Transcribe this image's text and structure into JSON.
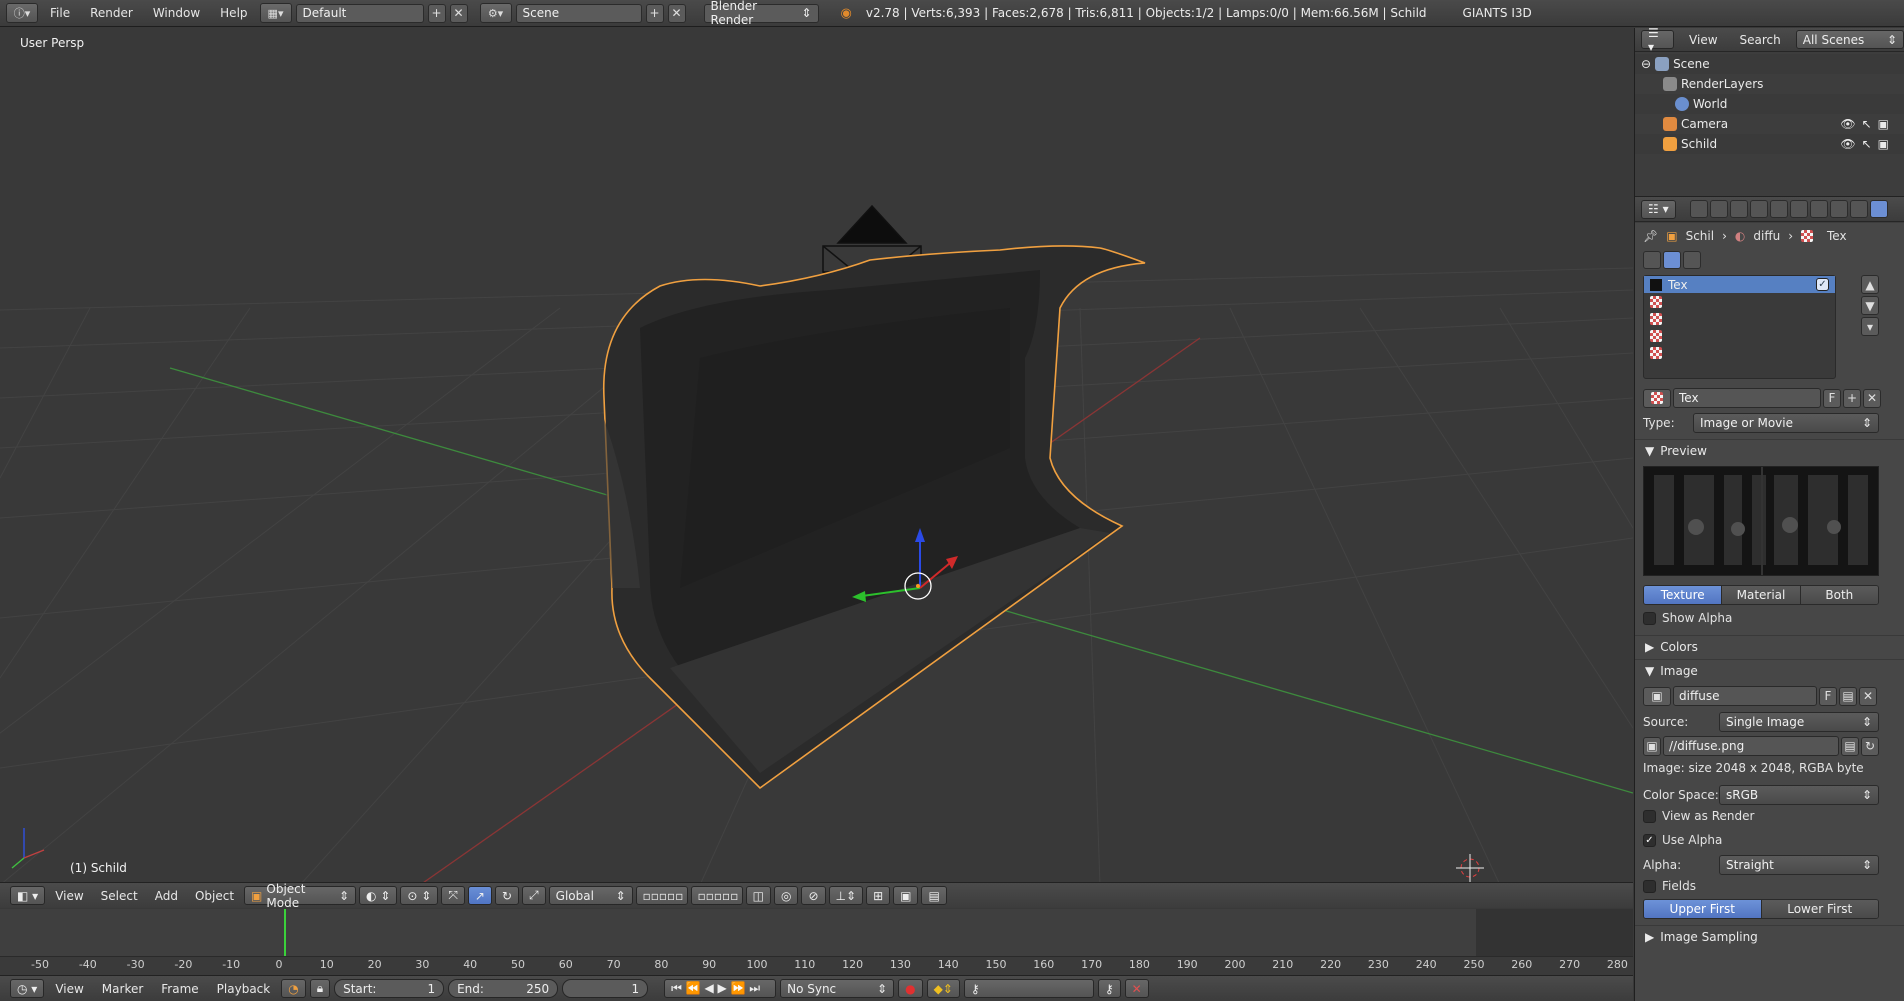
{
  "topbar": {
    "menus": [
      "File",
      "Render",
      "Window",
      "Help"
    ],
    "layout": "Default",
    "scene": "Scene",
    "engine": "Blender Render",
    "stats": "v2.78 | Verts:6,393 | Faces:2,678 | Tris:6,811 | Objects:1/2 | Lamps:0/0 | Mem:66.56M | Schild",
    "addon": "GIANTS I3D"
  },
  "viewport": {
    "view_label": "User Persp",
    "object_label": "(1) Schild"
  },
  "viewport_header": {
    "menus": [
      "View",
      "Select",
      "Add",
      "Object"
    ],
    "mode": "Object Mode",
    "orientation": "Global"
  },
  "timeline": {
    "ticks": [
      "-50",
      "-40",
      "-30",
      "-20",
      "-10",
      "0",
      "10",
      "20",
      "30",
      "40",
      "50",
      "60",
      "70",
      "80",
      "90",
      "100",
      "110",
      "120",
      "130",
      "140",
      "150",
      "160",
      "170",
      "180",
      "190",
      "200",
      "210",
      "220",
      "230",
      "240",
      "250",
      "260",
      "270",
      "280"
    ],
    "current_frame_value": 1,
    "menus": [
      "View",
      "Marker",
      "Frame",
      "Playback"
    ],
    "start_label": "Start:",
    "start_value": "1",
    "end_label": "End:",
    "end_value": "250",
    "current_frame": "1",
    "sync": "No Sync"
  },
  "outliner": {
    "header_menus": [
      "View",
      "Search"
    ],
    "scope": "All Scenes",
    "items": [
      "Scene",
      "RenderLayers",
      "World",
      "Camera",
      "Schild"
    ]
  },
  "properties": {
    "breadcrumb": [
      "Schil",
      "diffu",
      "Tex"
    ],
    "texture_slots": [
      "Tex",
      "",
      "",
      "",
      ""
    ],
    "texture_name": "Tex",
    "type_label": "Type:",
    "type_value": "Image or Movie",
    "preview_title": "Preview",
    "preview_tabs": [
      "Texture",
      "Material",
      "Both"
    ],
    "show_alpha": "Show Alpha",
    "colors_title": "Colors",
    "image_title": "Image",
    "image_name": "diffuse",
    "source_label": "Source:",
    "source_value": "Single Image",
    "filepath": "//diffuse.png",
    "image_info": "Image: size 2048 x 2048, RGBA byte",
    "color_space_label": "Color Space:",
    "color_space_value": "sRGB",
    "view_as_render": "View as Render",
    "use_alpha": "Use Alpha",
    "alpha_label": "Alpha:",
    "alpha_value": "Straight",
    "fields": "Fields",
    "field_order": [
      "Upper First",
      "Lower First"
    ],
    "image_sampling_title": "Image Sampling",
    "fake_user": "F"
  },
  "colors": {
    "accent": "#5680c2",
    "selection_outline": "#f0a040",
    "x_axis": "#c04040",
    "y_axis": "#40c040",
    "z_axis": "#3050e0"
  }
}
